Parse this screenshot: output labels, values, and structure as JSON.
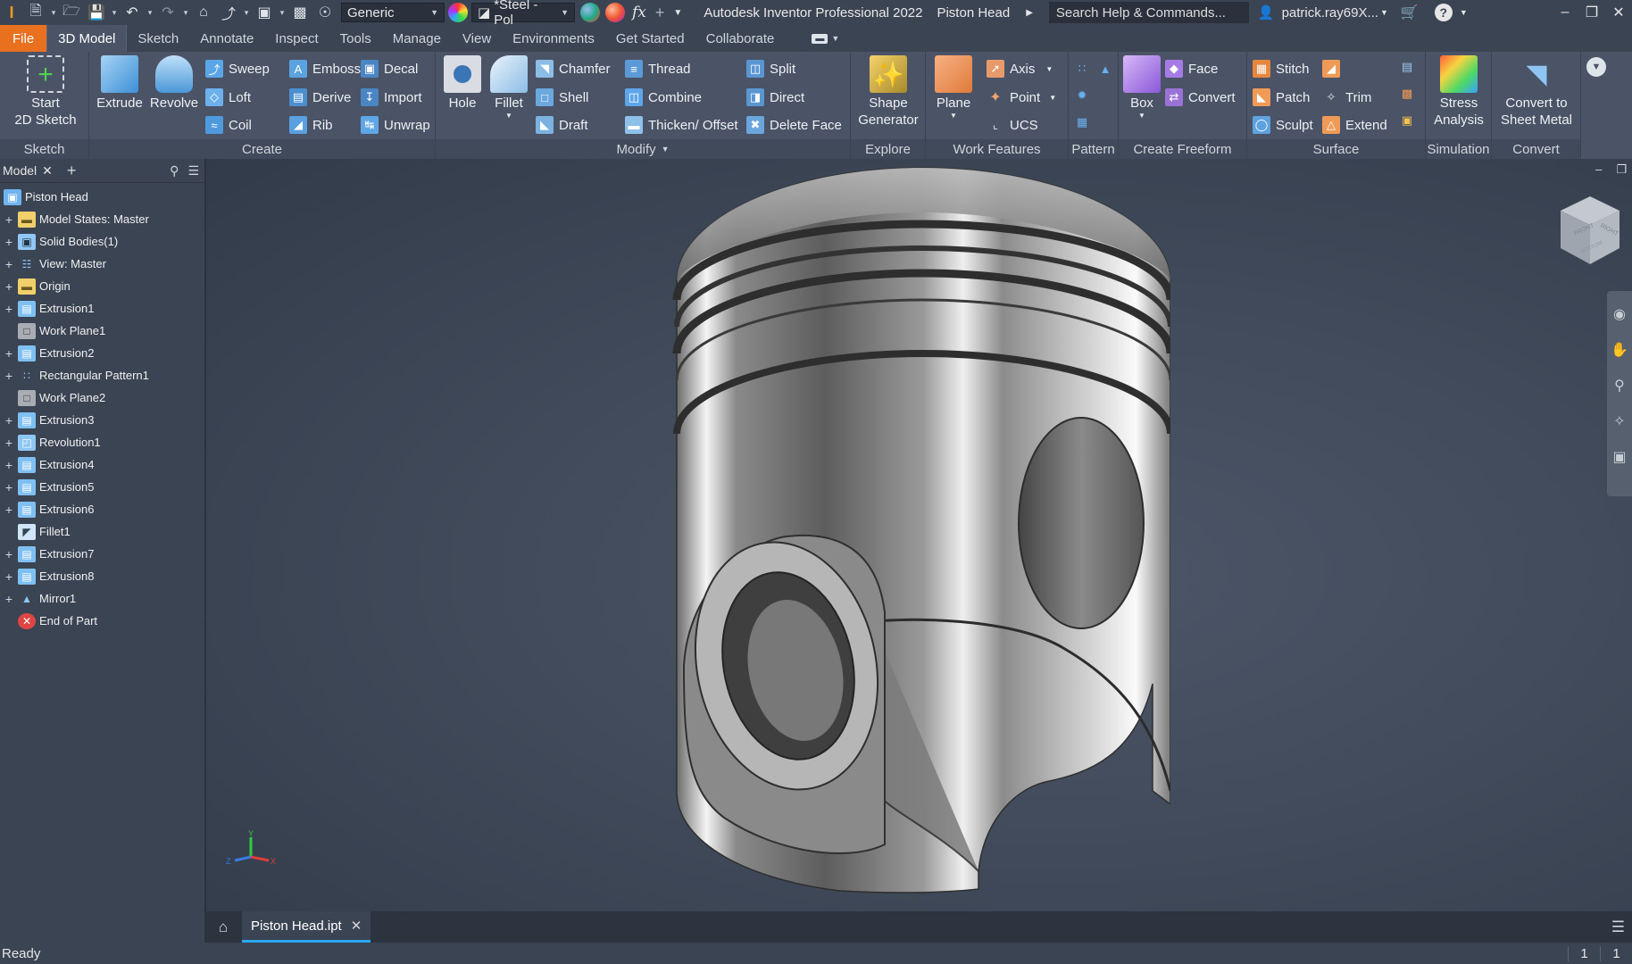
{
  "app": {
    "title": "Autodesk Inventor Professional 2022",
    "document": "Piston Head",
    "logo_letter": "I"
  },
  "quick_access": {
    "appearance_combo": "Generic",
    "material_combo": "*Steel - Pol",
    "search_placeholder": "Search Help & Commands...",
    "user": "patrick.ray69X..."
  },
  "ribbon_tabs": [
    "File",
    "3D Model",
    "Sketch",
    "Annotate",
    "Inspect",
    "Tools",
    "Manage",
    "View",
    "Environments",
    "Get Started",
    "Collaborate"
  ],
  "ribbon": {
    "sketch": {
      "label": "Sketch",
      "start_sketch": "Start\n2D Sketch"
    },
    "create": {
      "label": "Create",
      "extrude": "Extrude",
      "revolve": "Revolve",
      "sweep": "Sweep",
      "loft": "Loft",
      "coil": "Coil",
      "emboss": "Emboss",
      "derive": "Derive",
      "rib": "Rib",
      "decal": "Decal",
      "import": "Import",
      "unwrap": "Unwrap"
    },
    "modify": {
      "label": "Modify",
      "hole": "Hole",
      "fillet": "Fillet",
      "chamfer": "Chamfer",
      "shell": "Shell",
      "draft": "Draft",
      "thread": "Thread",
      "combine": "Combine",
      "thicken": "Thicken/ Offset",
      "split": "Split",
      "direct": "Direct",
      "delete_face": "Delete Face"
    },
    "explore": {
      "label": "Explore",
      "shape_generator": "Shape\nGenerator"
    },
    "work_features": {
      "label": "Work Features",
      "plane": "Plane",
      "axis": "Axis",
      "point": "Point",
      "ucs": "UCS"
    },
    "pattern": {
      "label": "Pattern"
    },
    "create_freeform": {
      "label": "Create Freeform",
      "box": "Box",
      "face": "Face",
      "convert": "Convert"
    },
    "surface": {
      "label": "Surface",
      "stitch": "Stitch",
      "patch": "Patch",
      "sculpt": "Sculpt",
      "trim": "Trim",
      "extend": "Extend"
    },
    "simulation": {
      "label": "Simulation",
      "stress": "Stress\nAnalysis"
    },
    "convert": {
      "label": "Convert",
      "sheet_metal": "Convert to\nSheet Metal"
    }
  },
  "browser": {
    "tab": "Model",
    "items": [
      {
        "label": "Piston Head",
        "icon": "part-icon",
        "expandable": false,
        "root": true
      },
      {
        "label": "Model States: Master",
        "icon": "folder-icon",
        "expandable": true
      },
      {
        "label": "Solid Bodies(1)",
        "icon": "solid-bodies-icon",
        "expandable": true
      },
      {
        "label": "View: Master",
        "icon": "view-icon",
        "expandable": true
      },
      {
        "label": "Origin",
        "icon": "folder-icon",
        "expandable": true
      },
      {
        "label": "Extrusion1",
        "icon": "extrusion-icon",
        "expandable": true
      },
      {
        "label": "Work Plane1",
        "icon": "work-plane-icon",
        "expandable": false
      },
      {
        "label": "Extrusion2",
        "icon": "extrusion-icon",
        "expandable": true
      },
      {
        "label": "Rectangular Pattern1",
        "icon": "pattern-icon",
        "expandable": true
      },
      {
        "label": "Work Plane2",
        "icon": "work-plane-icon",
        "expandable": false
      },
      {
        "label": "Extrusion3",
        "icon": "extrusion-icon",
        "expandable": true
      },
      {
        "label": "Revolution1",
        "icon": "revolve-icon",
        "expandable": true
      },
      {
        "label": "Extrusion4",
        "icon": "extrusion-icon",
        "expandable": true
      },
      {
        "label": "Extrusion5",
        "icon": "extrusion-icon",
        "expandable": true
      },
      {
        "label": "Extrusion6",
        "icon": "extrusion-icon",
        "expandable": true
      },
      {
        "label": "Fillet1",
        "icon": "fillet-icon",
        "expandable": false
      },
      {
        "label": "Extrusion7",
        "icon": "extrusion-icon",
        "expandable": true
      },
      {
        "label": "Extrusion8",
        "icon": "extrusion-icon",
        "expandable": true
      },
      {
        "label": "Mirror1",
        "icon": "mirror-icon",
        "expandable": true
      },
      {
        "label": "End of Part",
        "icon": "end-of-part-icon",
        "expandable": false
      }
    ]
  },
  "viewcube_labels": [
    "FRONT",
    "RIGHT",
    "BOTTOM"
  ],
  "doc_tab": "Piston Head.ipt",
  "status": {
    "text": "Ready",
    "count1": "1",
    "count2": "1"
  },
  "colors": {
    "accent": "#e8701e",
    "tab_underline": "#2aa7f2",
    "ribbon_bg": "#4a5466",
    "titlebar_bg": "#3b4453"
  }
}
